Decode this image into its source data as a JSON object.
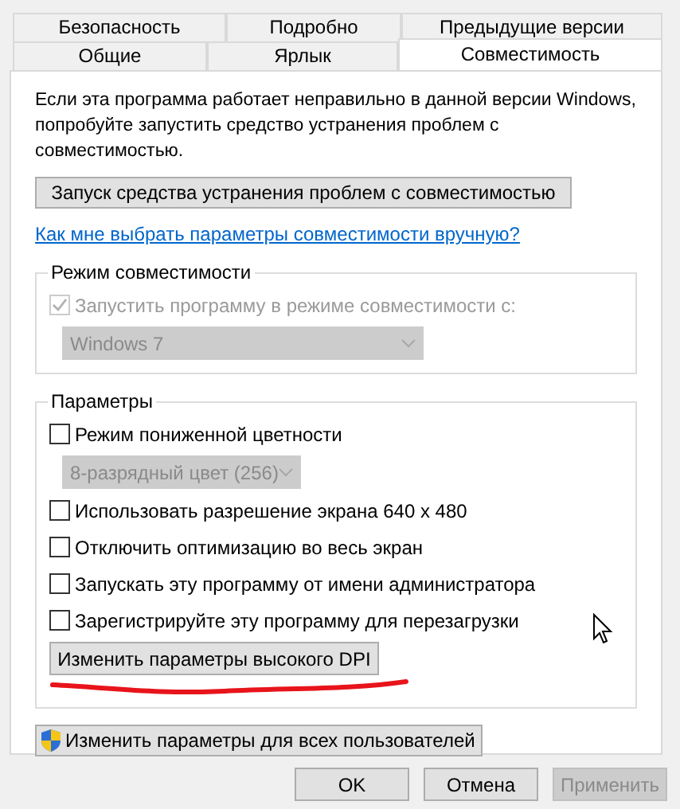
{
  "tab_rows": [
    [
      {
        "label": "Безопасность",
        "selected": false
      },
      {
        "label": "Подробно",
        "selected": false
      },
      {
        "label": "Предыдущие версии",
        "selected": false
      }
    ],
    [
      {
        "label": "Общие",
        "selected": false
      },
      {
        "label": "Ярлык",
        "selected": false
      },
      {
        "label": "Совместимость",
        "selected": true
      }
    ]
  ],
  "intro": "Если эта программа работает неправильно в данной версии Windows, попробуйте запустить средство устранения проблем с совместимостью.",
  "troubleshoot_button": "Запуск средства устранения проблем с совместимостью",
  "help_link": "Как мне выбрать параметры совместимости вручную?",
  "compat_group": {
    "title": "Режим совместимости",
    "items": [
      {
        "kind": "checkbox",
        "label": "Запустить программу в режиме совместимости с:",
        "checked": true,
        "disabled": true
      },
      {
        "kind": "dropdown",
        "value": "Windows 7",
        "disabled": true
      }
    ]
  },
  "settings_group": {
    "title": "Параметры",
    "items": [
      {
        "kind": "checkbox",
        "label": "Режим пониженной цветности",
        "checked": false,
        "disabled": false
      },
      {
        "kind": "dropdown",
        "value": "8-разрядный цвет (256)",
        "disabled": true
      },
      {
        "kind": "checkbox",
        "label": "Использовать разрешение экрана 640 x 480",
        "checked": false,
        "disabled": false
      },
      {
        "kind": "checkbox",
        "label": "Отключить оптимизацию во весь экран",
        "checked": false,
        "disabled": false
      },
      {
        "kind": "checkbox",
        "label": "Запускать эту программу от имени администратора",
        "checked": false,
        "disabled": false
      },
      {
        "kind": "checkbox",
        "label": "Зарегистрируйте эту программу для перезагрузки",
        "checked": false,
        "disabled": false
      },
      {
        "kind": "button",
        "label": "Изменить параметры высокого DPI"
      }
    ]
  },
  "all_users_button": "Изменить параметры для всех пользователей",
  "dialog_buttons": [
    {
      "label": "OK",
      "disabled": false
    },
    {
      "label": "Отмена",
      "disabled": false
    },
    {
      "label": "Применить",
      "disabled": true
    }
  ]
}
